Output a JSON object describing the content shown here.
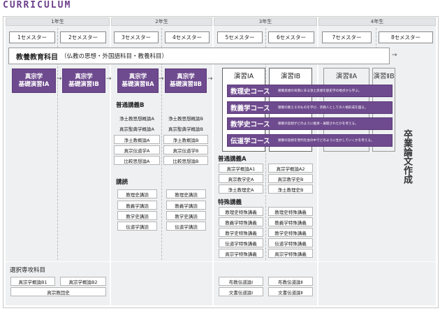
{
  "title": "CURRICULUM",
  "years": [
    "1年生",
    "2年生",
    "3年生",
    "4年生"
  ],
  "semesters": [
    "1セメスター",
    "2セメスター",
    "3セメスター",
    "4セメスター",
    "5セメスター",
    "6セメスター",
    "7セメスター",
    "8セメスター"
  ],
  "kyoyo": {
    "main": "教養教育科目",
    "sub": "（仏教の思想・外国語科目・教養科目）"
  },
  "kiso": [
    [
      "真宗学",
      "基礎演習ⅠA"
    ],
    [
      "真宗学",
      "基礎演習ⅠB"
    ],
    [
      "真宗学",
      "基礎演習ⅡA"
    ],
    [
      "真宗学",
      "基礎演習ⅡB"
    ]
  ],
  "enshu": [
    "演習ⅠA",
    "演習ⅠB",
    "演習ⅡA",
    "演習ⅡB"
  ],
  "courses": [
    {
      "name": "教理史コース",
      "desc": "親鸞思想の背景にある浄土思想を歴史学の視点から学ぶ。"
    },
    {
      "name": "教義学コース",
      "desc": "親鸞の教えそのものを学び、宗教人としての人格形成を図る。"
    },
    {
      "name": "教学史コース",
      "desc": "親鸞の思想がどのように継承・展開されたかを考える。"
    },
    {
      "name": "伝道学コース",
      "desc": "親鸞の思想を現代社会の中でどのように生かしていくかを考える。"
    }
  ],
  "futsuB": {
    "title": "普通講義B",
    "items": [
      "浄土教思想概論A",
      "浄土教思想概論B",
      "真宗聖典学概論A",
      "真宗聖典学概論B",
      "浄土教概論A",
      "浄土教概論B",
      "真宗伝道学A",
      "真宗伝道学B",
      "比較思想論A",
      "比較思想論B"
    ]
  },
  "kodoku": {
    "title": "講読",
    "items": [
      "教理史講読",
      "教理史講読",
      "教義学講読",
      "教義学講読",
      "教学史講読",
      "教学史講読",
      "伝道学講読",
      "伝道学講読"
    ]
  },
  "futsuA": {
    "title": "普通講義A",
    "items": [
      "真宗学概論A1",
      "真宗学概論A2",
      "真宗教学史A",
      "真宗教学史B",
      "浄土教理史A",
      "浄土教理史B"
    ]
  },
  "tokushu": {
    "title": "特殊講義",
    "items": [
      "教理史特殊講義",
      "教理史特殊講義",
      "教義学特殊講義",
      "教義学特殊講義",
      "教学史特殊講義",
      "教学史特殊講義",
      "伝道学特殊講義",
      "伝道学特殊講義",
      "真宗学特殊講義",
      "真宗学特殊講義"
    ]
  },
  "senta": {
    "title": "選択専攻科目",
    "items": [
      "真宗学概論B1",
      "真宗学概論B2",
      "真宗教団史"
    ]
  },
  "fukyo": [
    "布教伝道論Ⅰ",
    "布教伝道論Ⅱ",
    "文書伝道論Ⅰ",
    "文書伝道論Ⅱ"
  ],
  "sotsugyo": "卒業論文作成",
  "colors": {
    "purple": "#6e4a8e",
    "bg": "#eef0f2",
    "title": "#6b3f8c"
  }
}
